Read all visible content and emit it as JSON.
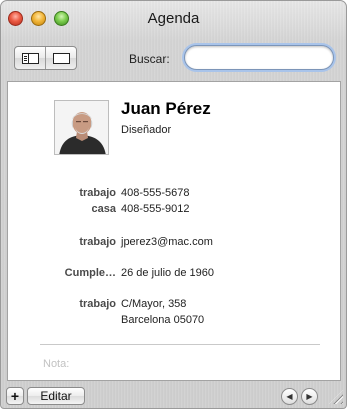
{
  "window": {
    "title": "Agenda"
  },
  "toolbar": {
    "view_buttons": [
      {
        "icon": "columns-view-icon"
      },
      {
        "icon": "card-view-icon"
      }
    ],
    "search": {
      "label": "Buscar:",
      "value": "",
      "placeholder": ""
    }
  },
  "card": {
    "name": "Juan Pérez",
    "job_title": "Diseñador",
    "fields": [
      {
        "label": "trabajo",
        "value": "408-555-5678"
      },
      {
        "label": "casa",
        "value": "408-555-9012"
      },
      {
        "label": "trabajo",
        "value": "jperez3@mac.com"
      },
      {
        "label": "Cumple…",
        "value": "26 de julio de 1960"
      },
      {
        "label": "trabajo",
        "value": "C/Mayor, 358"
      },
      {
        "label": "",
        "value": "Barcelona 05070"
      }
    ],
    "note_label": "Nota:"
  },
  "bottombar": {
    "add_label": "+",
    "edit_label": "Editar",
    "prev_label": "◀",
    "next_label": "▶"
  }
}
